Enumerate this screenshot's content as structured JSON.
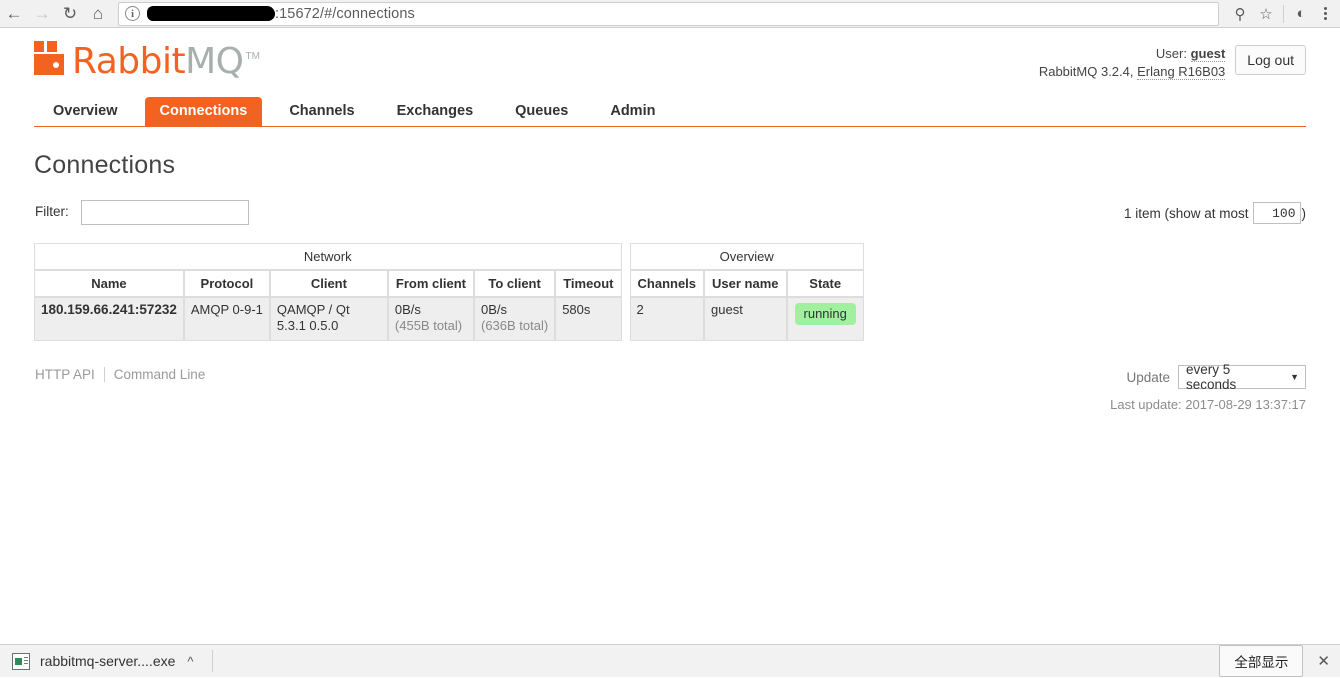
{
  "browser": {
    "back_icon": "back-arrow-icon",
    "forward_icon": "forward-arrow-icon",
    "reload_icon": "reload-icon",
    "home_icon": "home-icon",
    "info_glyph": "i",
    "url_text": ":15672/#/connections",
    "url_redacted": true,
    "pin_icon": "key-icon",
    "bookmark_icon": "star-icon",
    "profile_icon": "profile-avatar-icon",
    "menu_icon": "three-dot-menu-icon"
  },
  "header": {
    "logo_primary": "Rabbit",
    "logo_secondary": "MQ",
    "logo_tm": "TM",
    "user_prefix": "User:",
    "user_name": "guest",
    "version_text": "RabbitMQ 3.2.4,",
    "erlang_text": "Erlang R16B03",
    "logout_label": "Log out"
  },
  "tabs": [
    {
      "label": "Overview",
      "active": false
    },
    {
      "label": "Connections",
      "active": true
    },
    {
      "label": "Channels",
      "active": false
    },
    {
      "label": "Exchanges",
      "active": false
    },
    {
      "label": "Queues",
      "active": false
    },
    {
      "label": "Admin",
      "active": false
    }
  ],
  "main": {
    "title": "Connections",
    "filter_label": "Filter:",
    "filter_value": "",
    "filter_placeholder": "",
    "count_prefix": "1 item (show at most",
    "count_value": "100",
    "count_suffix": ")"
  },
  "table": {
    "groups": [
      {
        "label": "Network",
        "span": 6
      },
      {
        "label": "Overview",
        "span": 3
      }
    ],
    "columns": [
      "Name",
      "Protocol",
      "Client",
      "From client",
      "To client",
      "Timeout",
      "Channels",
      "User name",
      "State"
    ],
    "rows": [
      {
        "name": "180.159.66.241:57232",
        "protocol": "AMQP 0-9-1",
        "client": "QAMQP / Qt 5.3.1 0.5.0",
        "from_client_rate": "0B/s",
        "from_client_total": "(455B total)",
        "to_client_rate": "0B/s",
        "to_client_total": "(636B total)",
        "timeout": "580s",
        "channels": "2",
        "user_name": "guest",
        "state": "running"
      }
    ]
  },
  "footer": {
    "http_api_label": "HTTP API",
    "command_line_label": "Command Line",
    "update_label": "Update",
    "update_value": "every 5 seconds",
    "update_options": [
      "every 5 seconds"
    ],
    "last_update_label": "Last update: 2017-08-29 13:37:17"
  },
  "download_bar": {
    "file_name": "rabbitmq-server....exe",
    "caret_icon": "chevron-up-icon",
    "show_all_label": "全部显示",
    "close_icon": "close-icon"
  },
  "colors": {
    "accent": "#f26322",
    "logo_gray": "#a7b0ad",
    "state_green": "#a0f0a0",
    "row_bg": "#eeeeee"
  }
}
